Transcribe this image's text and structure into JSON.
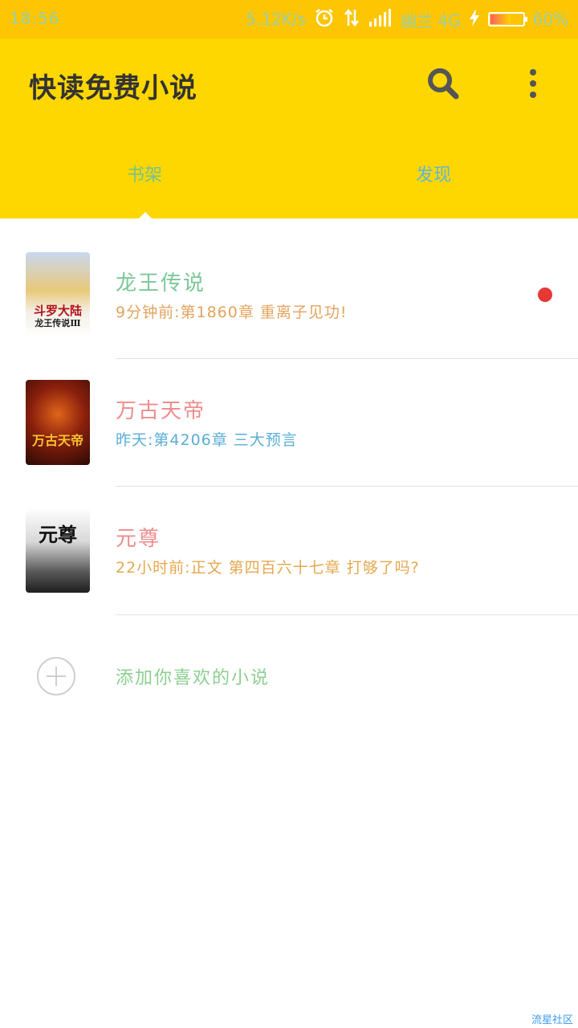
{
  "status_bar": {
    "time": "18:56",
    "network_speed": "5.12K/s",
    "carrier": "幽兰 4G",
    "battery": "60%",
    "battery_level": 0.6
  },
  "app_bar": {
    "title": "快读免费小说",
    "search_icon": "search-icon",
    "more_icon": "more-vert-icon",
    "background_color": "#ffd700"
  },
  "tabs": [
    {
      "label": "书架",
      "selected": true
    },
    {
      "label": "发现",
      "selected": false
    }
  ],
  "books": [
    {
      "title": "龙王传说",
      "update": "9分钟前:第1860章 重离子见功!",
      "cover_text": "斗罗大陆",
      "cover_subtext": "龙王传说Ⅲ",
      "unread": true
    },
    {
      "title": "万古天帝",
      "update": "昨天:第4206章   三大预言",
      "cover_text": "万古天帝",
      "cover_subtext": "",
      "unread": false
    },
    {
      "title": "元尊",
      "update": "22小时前:正文 第四百六十七章 打够了吗?",
      "cover_text": "元尊",
      "cover_subtext": "",
      "unread": false
    }
  ],
  "add_book": {
    "label": "添加你喜欢的小说",
    "icon": "add-circle-icon"
  },
  "watermark": "流星社区",
  "colors": {
    "accent": "#ffd700",
    "unread_dot": "#e53935"
  }
}
